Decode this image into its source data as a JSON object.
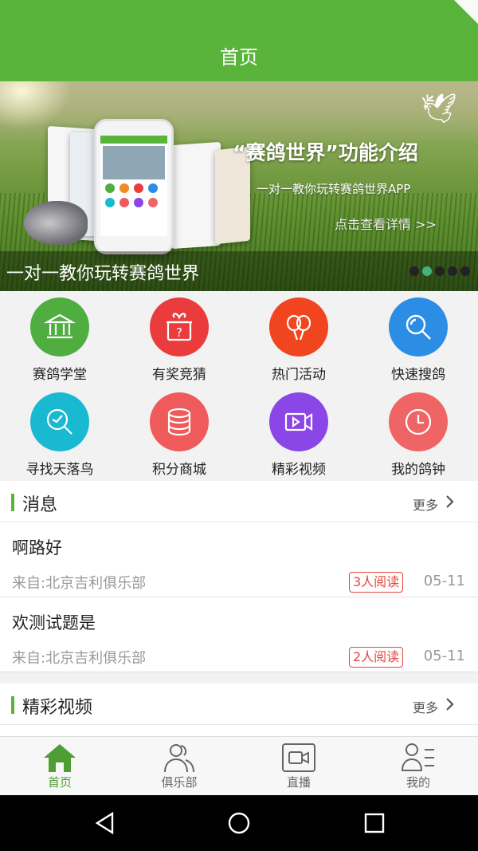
{
  "header": {
    "title": "首页"
  },
  "banner": {
    "title": "“赛鸽世界”功能介绍",
    "subtitle": "一对一教你玩转赛鸽世界APP",
    "link": "点击查看详情 >>",
    "caption": "一对一教你玩转赛鸽世界",
    "indicator_count": 5,
    "active_index": 1
  },
  "features": [
    {
      "label": "赛鸽学堂",
      "icon": "bank-icon",
      "color": "#4fae3f"
    },
    {
      "label": "有奖竞猜",
      "icon": "gift-question-icon",
      "color": "#ea3c3c"
    },
    {
      "label": "热门活动",
      "icon": "balloons-icon",
      "color": "#f0451f"
    },
    {
      "label": "快速搜鸽",
      "icon": "search-icon",
      "color": "#2b8de3"
    },
    {
      "label": "寻找天落鸟",
      "icon": "bird-search-icon",
      "color": "#19b9d1"
    },
    {
      "label": "积分商城",
      "icon": "database-icon",
      "color": "#ef5a5a"
    },
    {
      "label": "精彩视频",
      "icon": "video-icon",
      "color": "#8a46e6"
    },
    {
      "label": "我的鸽钟",
      "icon": "clock-icon",
      "color": "#ef6464"
    }
  ],
  "messages_section": {
    "title": "消息",
    "more": "更多",
    "items": [
      {
        "title": "啊路好",
        "source": "来自:北京吉利俱乐部",
        "reads": "3人阅读",
        "date": "05-11"
      },
      {
        "title": "欢测试题是",
        "source": "来自:北京吉利俱乐部",
        "reads": "2人阅读",
        "date": "05-11"
      }
    ]
  },
  "video_section": {
    "title": "精彩视频",
    "more": "更多"
  },
  "tabs": [
    {
      "label": "首页",
      "icon": "home-icon",
      "active": true
    },
    {
      "label": "俱乐部",
      "icon": "club-icon",
      "active": false
    },
    {
      "label": "直播",
      "icon": "live-video-icon",
      "active": false
    },
    {
      "label": "我的",
      "icon": "profile-icon",
      "active": false
    }
  ],
  "colors": {
    "primary": "#5ab33a",
    "badge": "#e0463c",
    "active_dot": "#45b27c"
  }
}
